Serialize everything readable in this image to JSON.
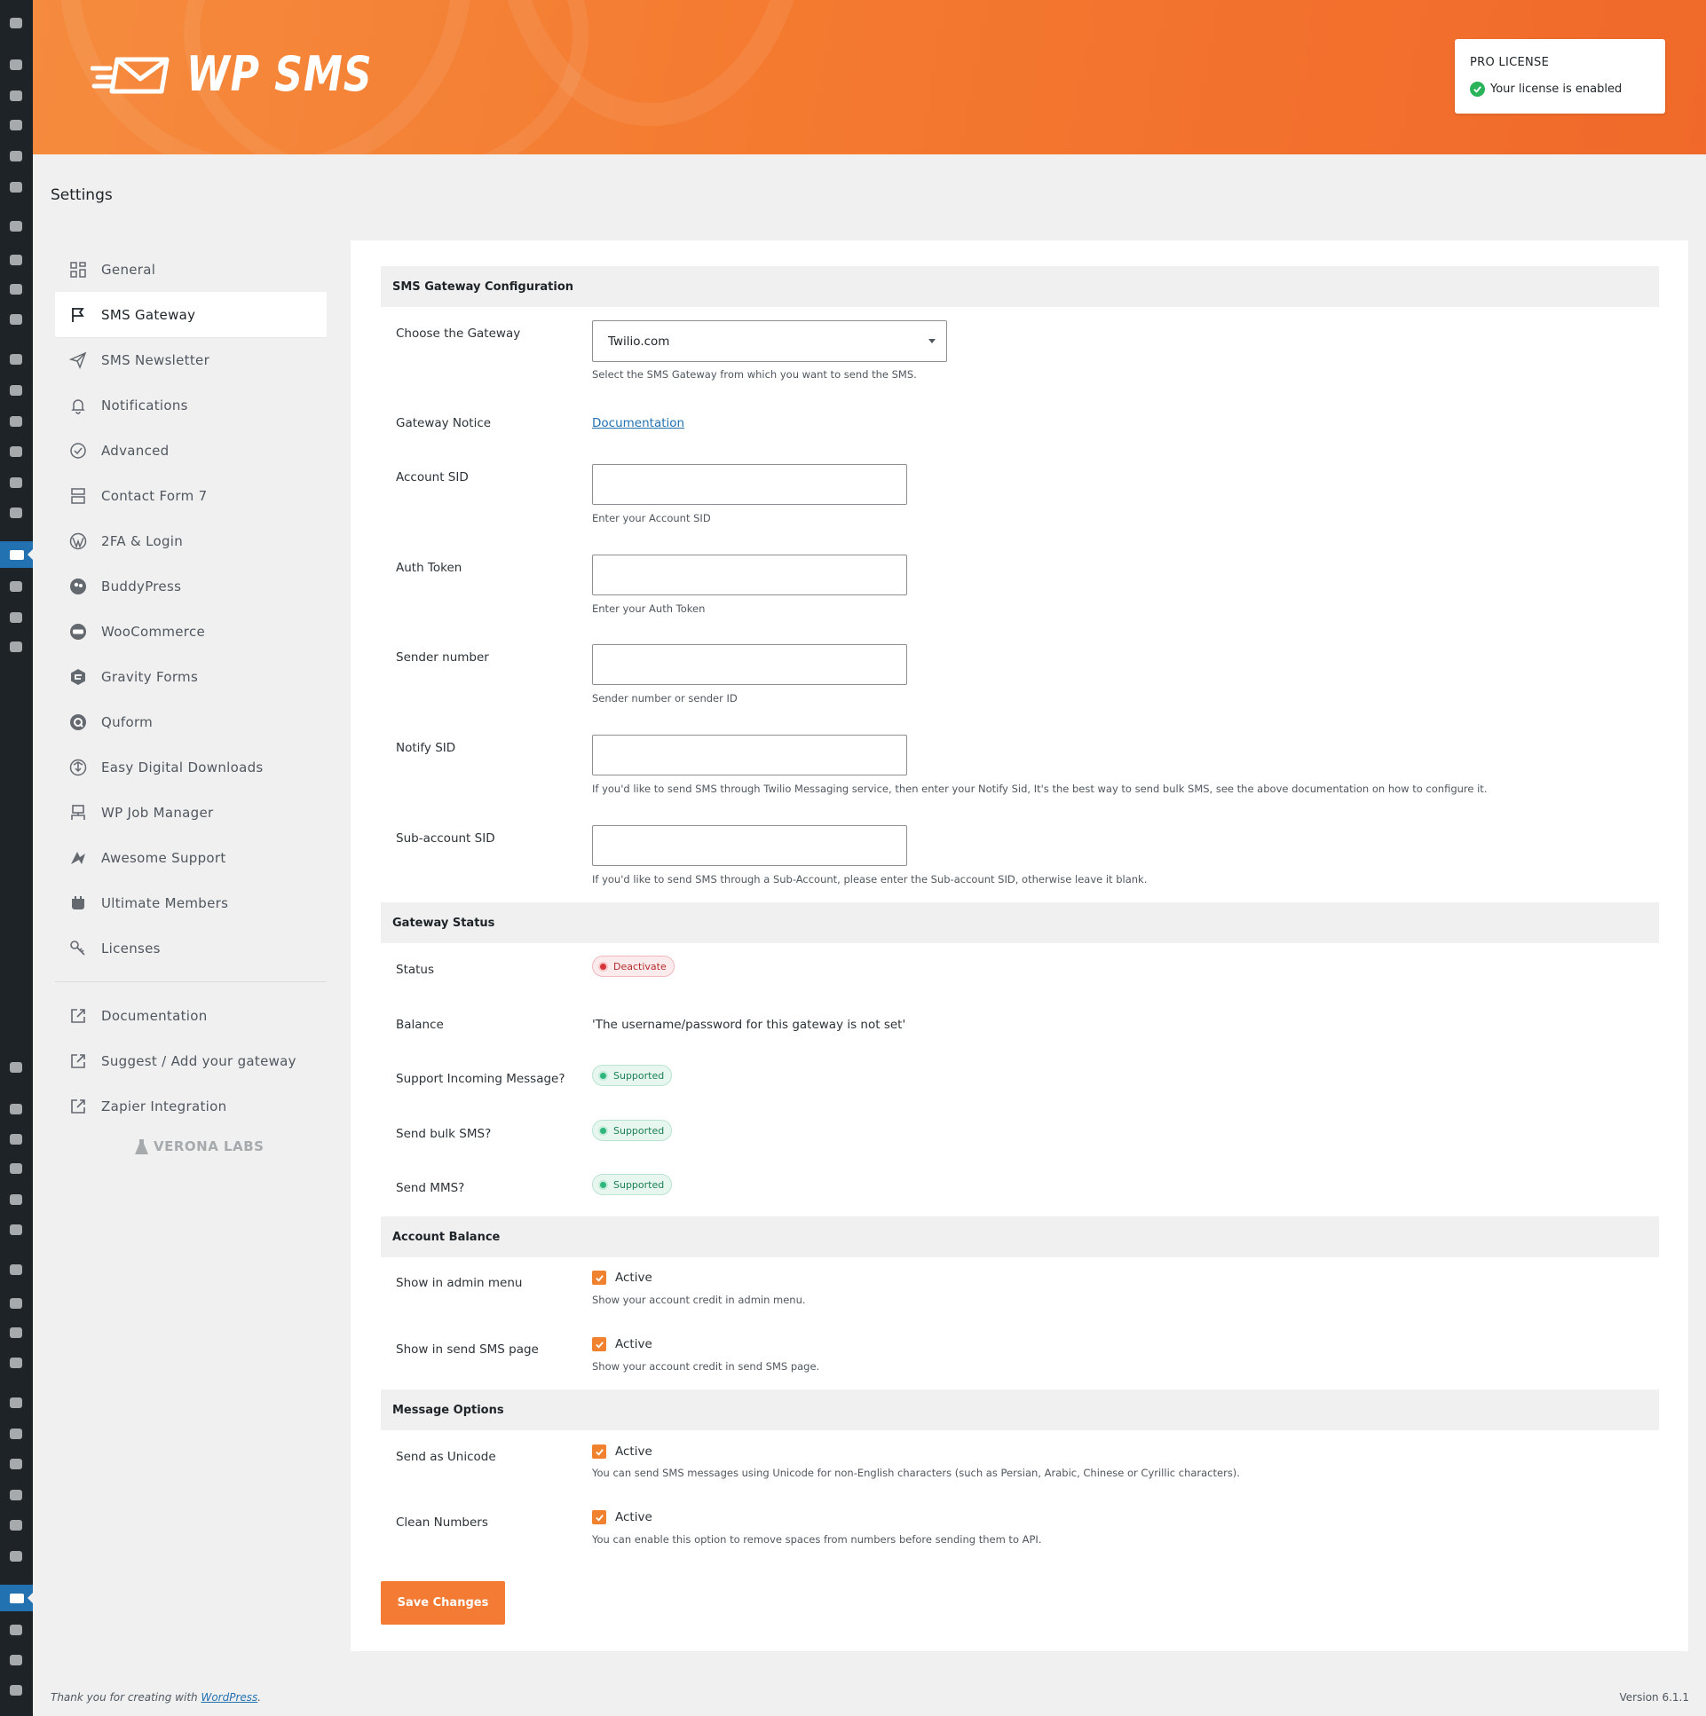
{
  "header": {
    "logo_text": "WP SMS",
    "license": {
      "title": "PRO LICENSE",
      "status": "Your license is enabled"
    }
  },
  "page_title": "Settings",
  "nav": {
    "items": [
      {
        "label": "General",
        "icon": "grid-icon"
      },
      {
        "label": "SMS Gateway",
        "icon": "flag-icon",
        "active": true
      },
      {
        "label": "SMS Newsletter",
        "icon": "send-icon"
      },
      {
        "label": "Notifications",
        "icon": "bell-icon"
      },
      {
        "label": "Advanced",
        "icon": "check-badge-icon"
      },
      {
        "label": "Contact Form 7",
        "icon": "form-icon"
      },
      {
        "label": "2FA & Login",
        "icon": "wordpress-icon"
      },
      {
        "label": "BuddyPress",
        "icon": "buddypress-icon"
      },
      {
        "label": "WooCommerce",
        "icon": "woocommerce-icon"
      },
      {
        "label": "Gravity Forms",
        "icon": "gravity-forms-icon"
      },
      {
        "label": "Quform",
        "icon": "quform-icon"
      },
      {
        "label": "Easy Digital Downloads",
        "icon": "edd-icon"
      },
      {
        "label": "WP Job Manager",
        "icon": "job-manager-icon"
      },
      {
        "label": "Awesome Support",
        "icon": "awesome-support-icon"
      },
      {
        "label": "Ultimate Members",
        "icon": "ultimate-member-icon"
      },
      {
        "label": "Licenses",
        "icon": "key-icon"
      }
    ],
    "links": [
      {
        "label": "Documentation",
        "icon": "external-link-icon"
      },
      {
        "label": "Suggest / Add your gateway",
        "icon": "external-link-icon"
      },
      {
        "label": "Zapier Integration",
        "icon": "external-link-icon"
      }
    ],
    "brand": "VERONA LABS"
  },
  "sections": {
    "gateway_config": {
      "title": "SMS Gateway Configuration",
      "choose_label": "Choose the Gateway",
      "choose_value": "Twilio.com",
      "choose_help": "Select the SMS Gateway from which you want to send the SMS.",
      "notice_label": "Gateway Notice",
      "notice_link": "Documentation",
      "account_sid_label": "Account SID",
      "account_sid_help": "Enter your Account SID",
      "auth_token_label": "Auth Token",
      "auth_token_help": "Enter your Auth Token",
      "sender_label": "Sender number",
      "sender_help": "Sender number or sender ID",
      "notify_label": "Notify SID",
      "notify_help": "If you'd like to send SMS through Twilio Messaging service, then enter your Notify Sid, It's the best way to send bulk SMS, see the above documentation on how to configure it.",
      "subaccount_label": "Sub-account SID",
      "subaccount_help": "If you'd like to send SMS through a Sub-Account, please enter the Sub-account SID, otherwise leave it blank."
    },
    "gateway_status": {
      "title": "Gateway Status",
      "status_label": "Status",
      "status_value": "Deactivate",
      "balance_label": "Balance",
      "balance_value": "'The username/password for this gateway is not set'",
      "incoming_label": "Support Incoming Message?",
      "incoming_value": "Supported",
      "bulk_label": "Send bulk SMS?",
      "bulk_value": "Supported",
      "mms_label": "Send MMS?",
      "mms_value": "Supported"
    },
    "account_balance": {
      "title": "Account Balance",
      "admin_menu_label": "Show in admin menu",
      "admin_menu_check": "Active",
      "admin_menu_help": "Show your account credit in admin menu.",
      "send_page_label": "Show in send SMS page",
      "send_page_check": "Active",
      "send_page_help": "Show your account credit in send SMS page."
    },
    "message_options": {
      "title": "Message Options",
      "unicode_label": "Send as Unicode",
      "unicode_check": "Active",
      "unicode_help": "You can send SMS messages using Unicode for non-English characters (such as Persian, Arabic, Chinese or Cyrillic characters).",
      "clean_label": "Clean Numbers",
      "clean_check": "Active",
      "clean_help": "You can enable this option to remove spaces from numbers before sending them to API."
    }
  },
  "save_label": "Save Changes",
  "footer": {
    "thanks_prefix": "Thank you for creating with ",
    "thanks_link": "WordPress",
    "thanks_suffix": ".",
    "version": "Version 6.1.1"
  },
  "colors": {
    "brand_orange": "#f47b33",
    "wp_dark": "#1d2327",
    "wp_blue": "#2271b1",
    "success_green": "#2bb35a",
    "danger_red": "#d63638"
  }
}
